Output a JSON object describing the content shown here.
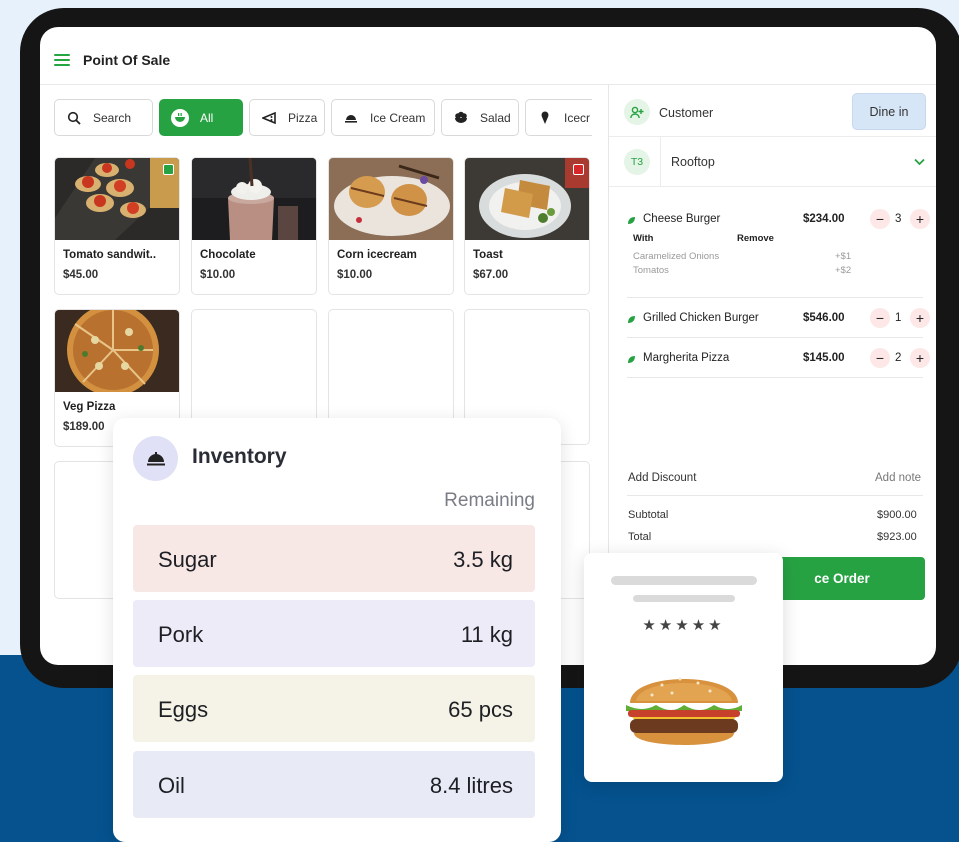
{
  "app": {
    "title": "Point Of Sale"
  },
  "categories": [
    {
      "label": "Search",
      "icon": "search-icon"
    },
    {
      "label": "All",
      "icon": "bowl-icon",
      "active": true
    },
    {
      "label": "Pizza",
      "icon": "pizza-icon"
    },
    {
      "label": "Ice Cream",
      "icon": "cloche-icon"
    },
    {
      "label": "Salad",
      "icon": "salad-icon"
    },
    {
      "label": "Icecr",
      "icon": "icecream-icon"
    }
  ],
  "products": [
    {
      "name": "Tomato sandwit..",
      "price": "$45.00",
      "diet": "veg",
      "diet_color": "#27a243"
    },
    {
      "name": "Chocolate",
      "price": "$10.00"
    },
    {
      "name": "Corn icecream",
      "price": "$10.00"
    },
    {
      "name": "Toast",
      "price": "$67.00",
      "diet": "non-veg",
      "diet_color": "#d62828"
    },
    {
      "name": "Veg Pizza",
      "price": "$189.00"
    }
  ],
  "order_panel": {
    "customer_label": "Customer",
    "dine_in_label": "Dine in",
    "table_code": "T3",
    "table_name": "Rooftop",
    "items": [
      {
        "name": "Cheese Burger",
        "price": "$234.00",
        "qty": "3"
      },
      {
        "name": "Grilled Chicken Burger",
        "price": "$546.00",
        "qty": "1"
      },
      {
        "name": "Margherita Pizza",
        "price": "$145.00",
        "qty": "2"
      }
    ],
    "modifiers": {
      "with_label": "With",
      "remove_label": "Remove",
      "rows": [
        {
          "name": "Caramelized Onions",
          "price": "+$1"
        },
        {
          "name": "Tomatos",
          "price": "+$2"
        }
      ]
    },
    "add_discount": "Add Discount",
    "add_note": "Add note",
    "subtotal_label": "Subtotal",
    "subtotal_value": "$900.00",
    "total_label": "Total",
    "total_value": "$923.00",
    "place_order_label": "ce Order"
  },
  "inventory": {
    "title": "Inventory",
    "column_label": "Remaining",
    "rows": [
      {
        "item": "Sugar",
        "remaining": "3.5 kg",
        "color": "#f7e8e6"
      },
      {
        "item": "Pork",
        "remaining": "11 kg",
        "color": "#ecebf7"
      },
      {
        "item": "Eggs",
        "remaining": "65 pcs",
        "color": "#f5f3e7"
      },
      {
        "item": "Oil",
        "remaining": "8.4 litres",
        "color": "#e8eaf6"
      }
    ]
  },
  "review_card": {
    "stars": "★★★★★",
    "rating": 5
  }
}
